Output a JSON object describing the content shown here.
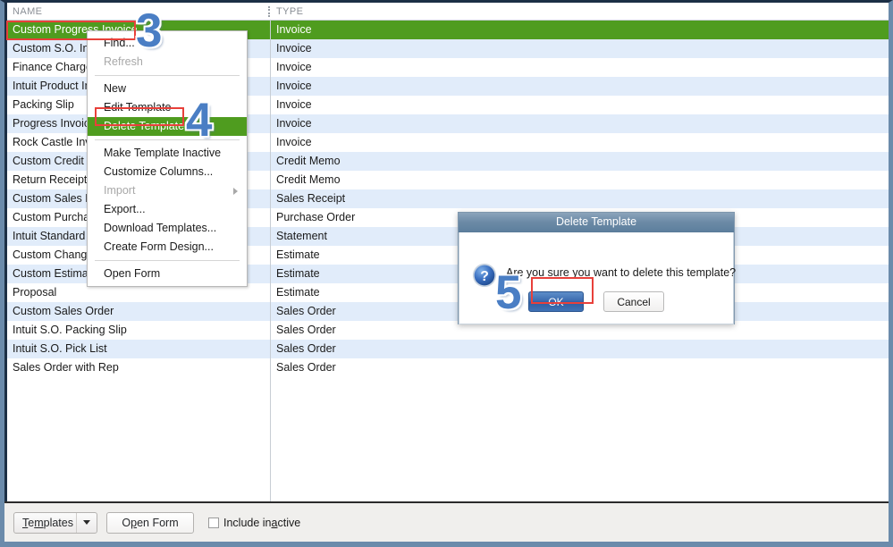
{
  "list": {
    "columns": {
      "name": "NAME",
      "type": "TYPE"
    },
    "rows": [
      {
        "name": "Custom Progress Invoice",
        "type": "Invoice",
        "selected": true
      },
      {
        "name": "Custom S.O. Invoice",
        "type": "Invoice"
      },
      {
        "name": "Finance Charge",
        "type": "Invoice"
      },
      {
        "name": "Intuit Product Invoice",
        "type": "Invoice"
      },
      {
        "name": "Packing Slip",
        "type": "Invoice"
      },
      {
        "name": "Progress Invoice",
        "type": "Invoice"
      },
      {
        "name": "Rock Castle Invoice",
        "type": "Invoice"
      },
      {
        "name": "Custom Credit Memo",
        "type": "Credit Memo"
      },
      {
        "name": "Return Receipt",
        "type": "Credit Memo"
      },
      {
        "name": "Custom Sales Receipt",
        "type": "Sales Receipt"
      },
      {
        "name": "Custom Purchase Order",
        "type": "Purchase Order"
      },
      {
        "name": "Intuit Standard Statement",
        "type": "Statement"
      },
      {
        "name": "Custom Change Order",
        "type": "Estimate"
      },
      {
        "name": "Custom Estimate",
        "type": "Estimate"
      },
      {
        "name": "Proposal",
        "type": "Estimate"
      },
      {
        "name": "Custom Sales Order",
        "type": "Sales Order"
      },
      {
        "name": "Intuit S.O. Packing Slip",
        "type": "Sales Order"
      },
      {
        "name": "Intuit S.O. Pick List",
        "type": "Sales Order"
      },
      {
        "name": "Sales Order with Rep",
        "type": "Sales Order"
      }
    ]
  },
  "context_menu": {
    "items": [
      {
        "label": "Find...",
        "state": "normal"
      },
      {
        "label": "Refresh",
        "state": "disabled"
      },
      {
        "separator": true
      },
      {
        "label": "New",
        "state": "normal"
      },
      {
        "label": "Edit Template",
        "state": "normal"
      },
      {
        "label": "Delete Template",
        "state": "highlighted"
      },
      {
        "separator": true
      },
      {
        "label": "Make Template Inactive",
        "state": "normal"
      },
      {
        "label": "Customize Columns...",
        "state": "normal"
      },
      {
        "label": "Import",
        "state": "disabled",
        "submenu": true
      },
      {
        "label": "Export...",
        "state": "normal"
      },
      {
        "label": "Download Templates...",
        "state": "normal"
      },
      {
        "label": "Create Form Design...",
        "state": "normal"
      },
      {
        "separator": true
      },
      {
        "label": "Open Form",
        "state": "normal"
      }
    ]
  },
  "dialog": {
    "title": "Delete Template",
    "message": "Are you sure you want to delete this template?",
    "ok_label": "OK",
    "cancel_label": "Cancel",
    "icon": "question-icon"
  },
  "toolbar": {
    "templates_label": "Templates",
    "open_form_label": "Open Form",
    "include_inactive_label": "Include inactive",
    "include_inactive_checked": false
  },
  "annotations": [
    {
      "number": "3",
      "target": "selected-row"
    },
    {
      "number": "4",
      "target": "delete-template-menu-item"
    },
    {
      "number": "5",
      "target": "dialog-ok-button"
    }
  ],
  "colors": {
    "selection_green": "#4f9c1f",
    "alt_row_blue": "#e1ecfa",
    "annotation_blue": "#4a7ec4",
    "highlight_red": "#e8403a",
    "frame_blue_grey": "#6b8bab"
  }
}
